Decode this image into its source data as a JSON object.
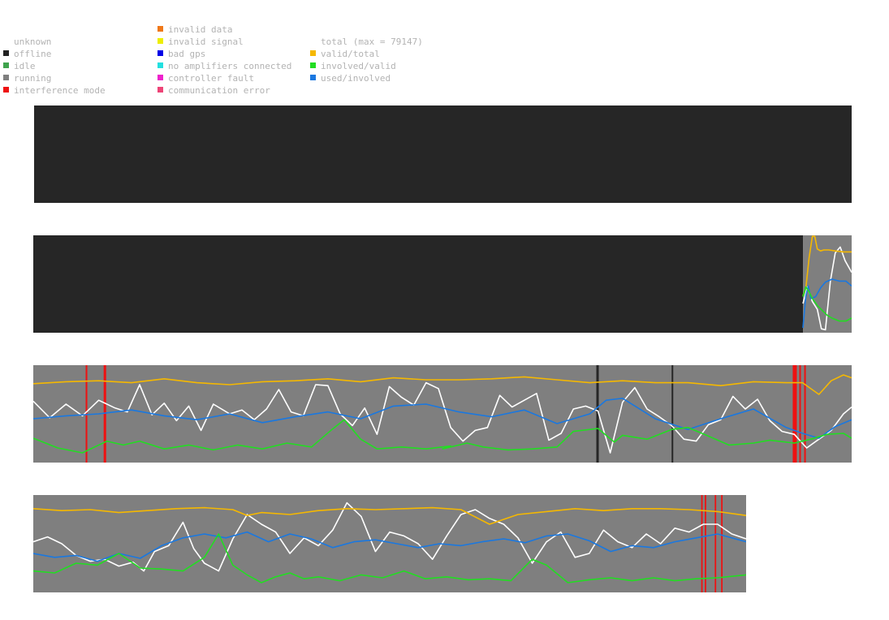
{
  "legend": {
    "status": [
      {
        "label": "unknown",
        "color": null
      },
      {
        "label": "offline",
        "color": "#222222"
      },
      {
        "label": "idle",
        "color": "#3fa34d"
      },
      {
        "label": "running",
        "color": "#7f7f7f"
      },
      {
        "label": "interference mode",
        "color": "#ee1111"
      }
    ],
    "faults": [
      {
        "label": "invalid data",
        "color": "#f07818"
      },
      {
        "label": "invalid signal",
        "color": "#eeee00"
      },
      {
        "label": "bad gps",
        "color": "#0000e6"
      },
      {
        "label": "no amplifiers connected",
        "color": "#22e0e0"
      },
      {
        "label": "controller fault",
        "color": "#ee22cc"
      },
      {
        "label": "communication error",
        "color": "#ee4477"
      }
    ],
    "metrics": [
      {
        "label": "total (max = 79147)",
        "color": null
      },
      {
        "label": "valid/total",
        "color": "#f5b800"
      },
      {
        "label": "involved/valid",
        "color": "#22dd22"
      },
      {
        "label": "used/involved",
        "color": "#1a78e0"
      }
    ]
  },
  "colors": {
    "offline_bg": "#262626",
    "running_bg": "#7f7f7f",
    "interference": "#ee1111",
    "offline_mark": "#262626",
    "total_line": "#ffffff",
    "valid_total": "#f5b800",
    "involved_valid": "#22dd22",
    "used_involved": "#1a78e0"
  },
  "chart_data": [
    {
      "type": "area",
      "panel": 1,
      "segments": [
        {
          "state": "offline",
          "from": 0,
          "to": 1
        }
      ],
      "interference": [],
      "offline_marks": [],
      "series": []
    },
    {
      "type": "line",
      "panel": 2,
      "segments": [
        {
          "state": "offline",
          "from": 0,
          "to": 0.9405
        },
        {
          "state": "running",
          "from": 0.9405,
          "to": 1
        }
      ],
      "interference": [],
      "offline_marks": [],
      "series": [
        {
          "key": "total",
          "x": [
            0.9405,
            0.946,
            0.952,
            0.958,
            0.963,
            0.968,
            0.974,
            0.98,
            0.986,
            0.992,
            1
          ],
          "y": [
            0.3,
            0.47,
            0.32,
            0.24,
            0.04,
            0.03,
            0.53,
            0.82,
            0.88,
            0.74,
            0.62
          ]
        },
        {
          "key": "valid_total",
          "x": [
            0.9405,
            0.944,
            0.948,
            0.952,
            0.955,
            0.958,
            0.962,
            0.966,
            0.972,
            0.98,
            0.99,
            1
          ],
          "y": [
            0.38,
            0.46,
            0.77,
            0.99,
            0.99,
            0.86,
            0.84,
            0.85,
            0.85,
            0.84,
            0.83,
            0.83
          ]
        },
        {
          "key": "involved_valid",
          "x": [
            0.9405,
            0.944,
            0.948,
            0.952,
            0.958,
            0.964,
            0.97,
            0.976,
            0.985,
            0.993,
            1
          ],
          "y": [
            0.37,
            0.47,
            0.42,
            0.35,
            0.28,
            0.23,
            0.18,
            0.15,
            0.12,
            0.12,
            0.15
          ]
        },
        {
          "key": "used_involved",
          "x": [
            0.9405,
            0.944,
            0.947,
            0.95,
            0.956,
            0.962,
            0.968,
            0.976,
            0.985,
            0.993,
            1
          ],
          "y": [
            0.05,
            0.38,
            0.48,
            0.35,
            0.37,
            0.46,
            0.52,
            0.55,
            0.53,
            0.53,
            0.48
          ]
        }
      ]
    },
    {
      "type": "line",
      "panel": 3,
      "segments": [
        {
          "state": "running",
          "from": 0,
          "to": 1
        }
      ],
      "interference": [
        {
          "x": 0.064,
          "w": 0.002
        },
        {
          "x": 0.086,
          "w": 0.003
        },
        {
          "x": 0.928,
          "w": 0.005
        },
        {
          "x": 0.936,
          "w": 0.002
        },
        {
          "x": 0.942,
          "w": 0.002
        }
      ],
      "offline_marks": [
        {
          "x": 0.688,
          "w": 0.003
        },
        {
          "x": 0.78,
          "w": 0.002
        }
      ],
      "series": [
        {
          "key": "total",
          "x": [
            0,
            0.02,
            0.04,
            0.06,
            0.08,
            0.1,
            0.115,
            0.13,
            0.145,
            0.16,
            0.175,
            0.19,
            0.205,
            0.22,
            0.24,
            0.255,
            0.27,
            0.285,
            0.3,
            0.315,
            0.33,
            0.345,
            0.36,
            0.375,
            0.39,
            0.405,
            0.42,
            0.435,
            0.45,
            0.465,
            0.48,
            0.495,
            0.51,
            0.525,
            0.54,
            0.555,
            0.57,
            0.585,
            0.6,
            0.615,
            0.63,
            0.645,
            0.66,
            0.675,
            0.69,
            0.705,
            0.72,
            0.735,
            0.75,
            0.765,
            0.78,
            0.795,
            0.81,
            0.825,
            0.84,
            0.855,
            0.87,
            0.885,
            0.9,
            0.915,
            0.93,
            0.945,
            0.96,
            0.975,
            0.99,
            1
          ],
          "y": [
            0.63,
            0.46,
            0.6,
            0.48,
            0.64,
            0.56,
            0.52,
            0.8,
            0.49,
            0.61,
            0.43,
            0.58,
            0.33,
            0.6,
            0.5,
            0.54,
            0.44,
            0.55,
            0.75,
            0.52,
            0.48,
            0.8,
            0.79,
            0.5,
            0.38,
            0.56,
            0.29,
            0.78,
            0.67,
            0.59,
            0.82,
            0.76,
            0.36,
            0.22,
            0.33,
            0.36,
            0.69,
            0.57,
            0.64,
            0.71,
            0.23,
            0.3,
            0.55,
            0.58,
            0.53,
            0.1,
            0.62,
            0.77,
            0.55,
            0.47,
            0.38,
            0.24,
            0.22,
            0.39,
            0.44,
            0.68,
            0.55,
            0.65,
            0.43,
            0.32,
            0.29,
            0.15,
            0.24,
            0.33,
            0.5,
            0.57
          ]
        },
        {
          "key": "valid_total",
          "x": [
            0,
            0.04,
            0.08,
            0.12,
            0.16,
            0.2,
            0.24,
            0.28,
            0.32,
            0.36,
            0.4,
            0.44,
            0.48,
            0.52,
            0.56,
            0.6,
            0.64,
            0.68,
            0.72,
            0.76,
            0.8,
            0.84,
            0.88,
            0.92,
            0.94,
            0.96,
            0.975,
            0.99,
            1
          ],
          "y": [
            0.81,
            0.83,
            0.84,
            0.82,
            0.86,
            0.82,
            0.8,
            0.83,
            0.84,
            0.86,
            0.83,
            0.87,
            0.85,
            0.85,
            0.86,
            0.88,
            0.85,
            0.82,
            0.84,
            0.82,
            0.82,
            0.79,
            0.83,
            0.82,
            0.82,
            0.7,
            0.84,
            0.9,
            0.87
          ]
        },
        {
          "key": "used_involved",
          "x": [
            0,
            0.04,
            0.08,
            0.12,
            0.16,
            0.2,
            0.24,
            0.28,
            0.32,
            0.36,
            0.4,
            0.44,
            0.48,
            0.52,
            0.56,
            0.6,
            0.64,
            0.68,
            0.7,
            0.72,
            0.76,
            0.8,
            0.84,
            0.88,
            0.92,
            0.94,
            0.96,
            0.98,
            1
          ],
          "y": [
            0.45,
            0.48,
            0.5,
            0.54,
            0.48,
            0.44,
            0.5,
            0.41,
            0.47,
            0.52,
            0.45,
            0.58,
            0.6,
            0.52,
            0.47,
            0.54,
            0.4,
            0.5,
            0.64,
            0.66,
            0.45,
            0.34,
            0.45,
            0.55,
            0.36,
            0.3,
            0.25,
            0.37,
            0.44
          ]
        },
        {
          "key": "involved_valid",
          "x": [
            0,
            0.03,
            0.06,
            0.09,
            0.11,
            0.13,
            0.16,
            0.19,
            0.22,
            0.25,
            0.28,
            0.31,
            0.34,
            0.365,
            0.38,
            0.4,
            0.42,
            0.45,
            0.48,
            0.51,
            0.5,
            0.53,
            0.55,
            0.58,
            0.61,
            0.64,
            0.66,
            0.69,
            0.71,
            0.72,
            0.75,
            0.78,
            0.8,
            0.82,
            0.85,
            0.88,
            0.9,
            0.93,
            0.95,
            0.97,
            0.99,
            1
          ],
          "y": [
            0.25,
            0.15,
            0.1,
            0.22,
            0.18,
            0.22,
            0.14,
            0.18,
            0.13,
            0.18,
            0.14,
            0.2,
            0.16,
            0.34,
            0.44,
            0.24,
            0.14,
            0.16,
            0.14,
            0.17,
            0.14,
            0.2,
            0.16,
            0.13,
            0.14,
            0.16,
            0.32,
            0.35,
            0.21,
            0.28,
            0.24,
            0.34,
            0.36,
            0.29,
            0.18,
            0.2,
            0.23,
            0.2,
            0.24,
            0.29,
            0.3,
            0.25
          ]
        }
      ]
    },
    {
      "type": "line",
      "panel": 4,
      "segments": [
        {
          "state": "running",
          "from": 0,
          "to": 1
        }
      ],
      "interference": [
        {
          "x": 0.937,
          "w": 0.002
        },
        {
          "x": 0.942,
          "w": 0.002
        },
        {
          "x": 0.956,
          "w": 0.002
        },
        {
          "x": 0.965,
          "w": 0.002
        }
      ],
      "offline_marks": [],
      "series": [
        {
          "key": "total",
          "x": [
            0,
            0.02,
            0.04,
            0.06,
            0.08,
            0.1,
            0.12,
            0.14,
            0.155,
            0.17,
            0.19,
            0.21,
            0.225,
            0.24,
            0.26,
            0.28,
            0.3,
            0.32,
            0.34,
            0.36,
            0.38,
            0.4,
            0.42,
            0.44,
            0.46,
            0.48,
            0.5,
            0.52,
            0.54,
            0.56,
            0.58,
            0.6,
            0.62,
            0.64,
            0.66,
            0.68,
            0.7,
            0.72,
            0.74,
            0.76,
            0.78,
            0.8,
            0.82,
            0.84,
            0.86,
            0.88,
            0.9,
            0.92,
            0.94,
            0.96,
            0.98,
            1
          ],
          "y": [
            0.52,
            0.57,
            0.5,
            0.38,
            0.32,
            0.34,
            0.27,
            0.31,
            0.22,
            0.42,
            0.48,
            0.72,
            0.45,
            0.3,
            0.22,
            0.55,
            0.8,
            0.7,
            0.62,
            0.4,
            0.56,
            0.48,
            0.64,
            0.92,
            0.78,
            0.42,
            0.62,
            0.58,
            0.5,
            0.34,
            0.58,
            0.8,
            0.85,
            0.76,
            0.7,
            0.56,
            0.3,
            0.52,
            0.62,
            0.36,
            0.4,
            0.64,
            0.52,
            0.46,
            0.6,
            0.5,
            0.66,
            0.62,
            0.7,
            0.7,
            0.6,
            0.55
          ]
        },
        {
          "key": "valid_total",
          "x": [
            0,
            0.04,
            0.08,
            0.12,
            0.16,
            0.2,
            0.24,
            0.28,
            0.3,
            0.32,
            0.36,
            0.4,
            0.44,
            0.48,
            0.52,
            0.56,
            0.6,
            0.64,
            0.68,
            0.72,
            0.76,
            0.8,
            0.84,
            0.88,
            0.92,
            0.96,
            1
          ],
          "y": [
            0.86,
            0.84,
            0.85,
            0.82,
            0.84,
            0.86,
            0.87,
            0.85,
            0.79,
            0.82,
            0.8,
            0.84,
            0.86,
            0.85,
            0.86,
            0.87,
            0.85,
            0.7,
            0.8,
            0.83,
            0.86,
            0.84,
            0.86,
            0.86,
            0.85,
            0.83,
            0.79
          ]
        },
        {
          "key": "used_involved",
          "x": [
            0,
            0.03,
            0.06,
            0.09,
            0.12,
            0.15,
            0.18,
            0.21,
            0.24,
            0.27,
            0.3,
            0.33,
            0.36,
            0.39,
            0.42,
            0.45,
            0.48,
            0.51,
            0.54,
            0.57,
            0.6,
            0.63,
            0.66,
            0.69,
            0.72,
            0.75,
            0.78,
            0.81,
            0.84,
            0.87,
            0.9,
            0.93,
            0.96,
            1
          ],
          "y": [
            0.4,
            0.36,
            0.38,
            0.32,
            0.4,
            0.35,
            0.48,
            0.56,
            0.6,
            0.56,
            0.62,
            0.52,
            0.6,
            0.55,
            0.46,
            0.52,
            0.54,
            0.5,
            0.46,
            0.5,
            0.48,
            0.52,
            0.55,
            0.51,
            0.58,
            0.6,
            0.53,
            0.42,
            0.48,
            0.46,
            0.52,
            0.56,
            0.6,
            0.52
          ]
        },
        {
          "key": "involved_valid",
          "x": [
            0,
            0.03,
            0.06,
            0.09,
            0.12,
            0.15,
            0.18,
            0.21,
            0.24,
            0.26,
            0.28,
            0.3,
            0.32,
            0.34,
            0.36,
            0.38,
            0.4,
            0.43,
            0.46,
            0.49,
            0.52,
            0.55,
            0.58,
            0.61,
            0.64,
            0.67,
            0.7,
            0.72,
            0.75,
            0.78,
            0.81,
            0.84,
            0.87,
            0.9,
            0.93,
            0.96,
            1
          ],
          "y": [
            0.22,
            0.2,
            0.3,
            0.28,
            0.4,
            0.25,
            0.24,
            0.22,
            0.36,
            0.6,
            0.28,
            0.18,
            0.1,
            0.16,
            0.2,
            0.14,
            0.16,
            0.12,
            0.18,
            0.15,
            0.22,
            0.14,
            0.16,
            0.13,
            0.14,
            0.12,
            0.34,
            0.28,
            0.1,
            0.13,
            0.15,
            0.12,
            0.15,
            0.12,
            0.14,
            0.15,
            0.18
          ]
        }
      ]
    }
  ]
}
